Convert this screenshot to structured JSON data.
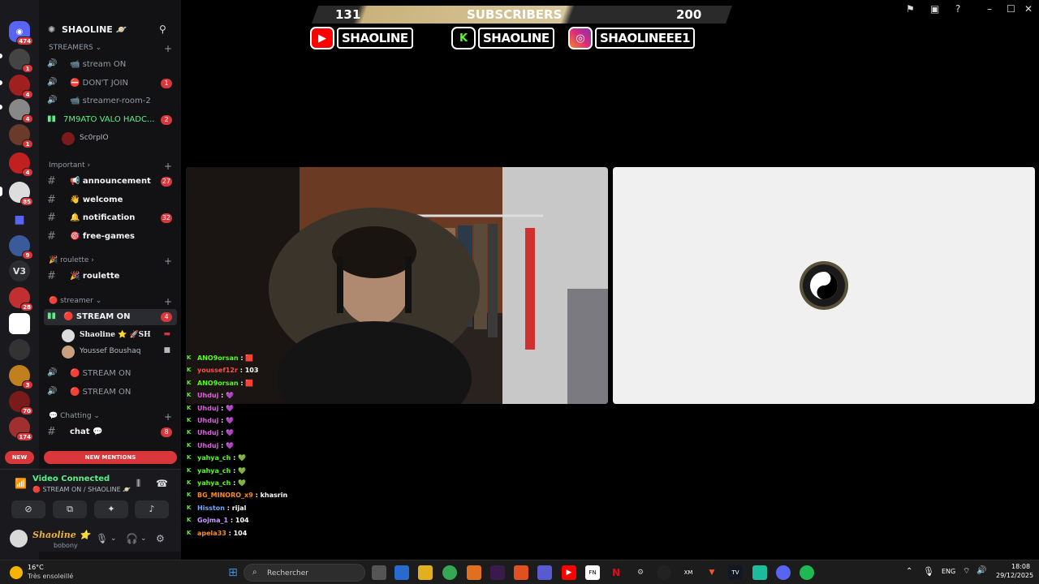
{
  "banner": {
    "count_left": "131",
    "label": "SUBSCRIBERS",
    "count_right": "200",
    "socials": [
      {
        "platform": "youtube-icon",
        "handle": "SHAOLINE"
      },
      {
        "platform": "kick-icon",
        "handle": "SHAOLINE"
      },
      {
        "platform": "instagram-icon",
        "handle": "SHAOLINEEE1"
      }
    ]
  },
  "rail": {
    "home_badge": "474",
    "servers": [
      {
        "badge": "1"
      },
      {
        "badge": "4"
      },
      {
        "badge": "4"
      },
      {
        "badge": "1"
      },
      {
        "badge": "4"
      },
      {
        "badge": "85"
      },
      {
        "badge": ""
      },
      {
        "badge": "9"
      },
      {
        "label": "V3",
        "badge": ""
      },
      {
        "badge": "28"
      },
      {
        "badge": ""
      },
      {
        "badge": ""
      },
      {
        "badge": "3"
      },
      {
        "badge": "70"
      },
      {
        "badge": "174"
      }
    ]
  },
  "server": {
    "name": "SHAOLINE 🪐",
    "categories": {
      "streamers": "STREAMERS",
      "important": "Important",
      "roulette": "roulette",
      "streamer": "streamer",
      "chatting": "Chatting"
    },
    "channels": {
      "stream_on_1": {
        "label": "📹 stream ON"
      },
      "dont_join": {
        "label": "⛔ DON'T JOIN",
        "count": "1"
      },
      "streamer_room": {
        "label": "📹 streamer-room-2"
      },
      "valo": {
        "label": "7M9ATO VALO HADC...",
        "count": "2"
      },
      "announcement": {
        "label": "📢 announcement",
        "count": "27"
      },
      "welcome": {
        "label": "👋 welcome"
      },
      "notification": {
        "label": "🔔 notification",
        "count": "32"
      },
      "free_games": {
        "label": "🎯 free-games"
      },
      "roulette": {
        "label": "🎉 roulette"
      },
      "stream_on_main": {
        "label": "🔴 STREAM ON",
        "count": "4"
      },
      "stream_on_2": {
        "label": "🔴 STREAM ON"
      },
      "stream_on_3": {
        "label": "🔴 STREAM ON"
      },
      "chat": {
        "label": "chat 💬",
        "count": "8"
      }
    },
    "members": {
      "valo_member": "Sc0rpIO",
      "shaoline": "Shaoline ⭐ 🚀SH",
      "youssef": "Youssef Boushaq"
    },
    "new_label": "NEW",
    "new_mentions_label": "NEW MENTIONS"
  },
  "voice": {
    "status": "Video Connected",
    "channel": "🔴 STREAM ON / SHAOLINE 🪐"
  },
  "user": {
    "name": "Shaoline ⭐",
    "status": "bobony"
  },
  "chat": [
    {
      "user": "ANO9orsan",
      "color": "#53fc18",
      "text": "🟥"
    },
    {
      "user": "youssef12r",
      "color": "#ff4d4d",
      "text": "103"
    },
    {
      "user": "ANO9orsan",
      "color": "#53fc18",
      "text": "🟥"
    },
    {
      "user": "Uhduj",
      "color": "#e05ee0",
      "text": "💜"
    },
    {
      "user": "Uhduj",
      "color": "#e05ee0",
      "text": "💜"
    },
    {
      "user": "Uhduj",
      "color": "#e05ee0",
      "text": "💜"
    },
    {
      "user": "Uhduj",
      "color": "#e05ee0",
      "text": "💜"
    },
    {
      "user": "Uhduj",
      "color": "#e05ee0",
      "text": "💜"
    },
    {
      "user": "yahya_ch",
      "color": "#53fc18",
      "text": "💚"
    },
    {
      "user": "yahya_ch",
      "color": "#53fc18",
      "text": "💚"
    },
    {
      "user": "yahya_ch",
      "color": "#53fc18",
      "text": "💚"
    },
    {
      "user": "BG_MINORO_x9",
      "color": "#ff8c1a",
      "text": "khasrin"
    },
    {
      "user": "Hisston",
      "color": "#7aa7ff",
      "text": "rijal"
    },
    {
      "user": "Gojma_1",
      "color": "#c79cff",
      "text": "104"
    },
    {
      "user": "apela33",
      "color": "#ff8c1a",
      "text": "104"
    }
  ],
  "taskbar": {
    "weather_temp": "16°C",
    "weather_desc": "Très ensoleillé",
    "search_placeholder": "Rechercher",
    "lang": "ENG",
    "time": "18:08",
    "date": "29/12/2025"
  },
  "colors": {
    "discord_bg": "#121214",
    "accent_red": "#da373c",
    "voice_green": "#57f287",
    "kick_green": "#53fc18"
  }
}
